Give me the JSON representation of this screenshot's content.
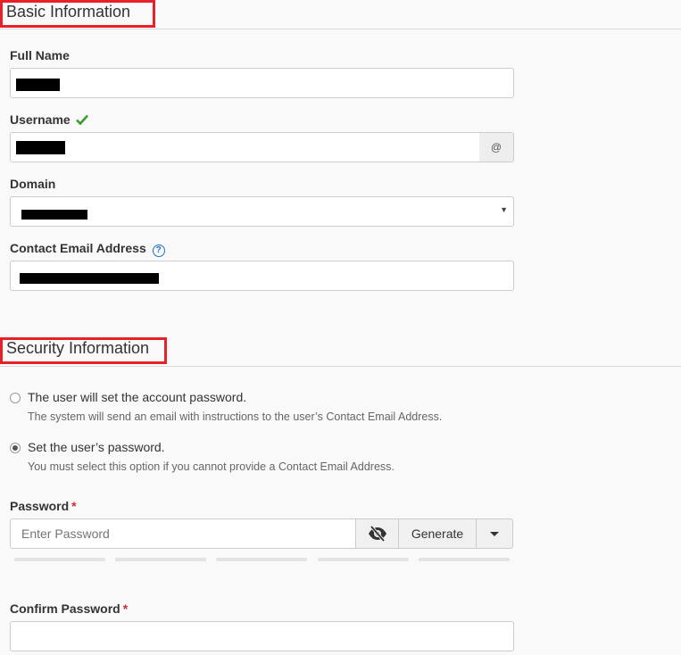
{
  "basic": {
    "title": "Basic Information",
    "full_name_label": "Full Name",
    "username_label": "Username",
    "username_addon": "@",
    "domain_label": "Domain",
    "contact_email_label": "Contact Email Address"
  },
  "security": {
    "title": "Security Information",
    "option_user_sets": {
      "label": "The user will set the account password.",
      "help": "The system will send an email with instructions to the user’s Contact Email Address.",
      "selected": false
    },
    "option_set_password": {
      "label": "Set the user’s password.",
      "help": "You must select this option if you cannot provide a Contact Email Address.",
      "selected": true
    },
    "password_label": "Password",
    "required_marker": "*",
    "password_placeholder": "Enter Password",
    "generate_label": "Generate",
    "confirm_password_label": "Confirm Password"
  },
  "colors": {
    "highlight_border": "#e8202a",
    "required": "#c9302c",
    "valid_check": "#3c9a2e",
    "help_icon": "#1a73c9"
  },
  "icons": {
    "valid": "checkmark-icon",
    "help": "question-circle-icon",
    "visibility": "eye-slash-icon",
    "dropdown": "caret-down-icon"
  }
}
